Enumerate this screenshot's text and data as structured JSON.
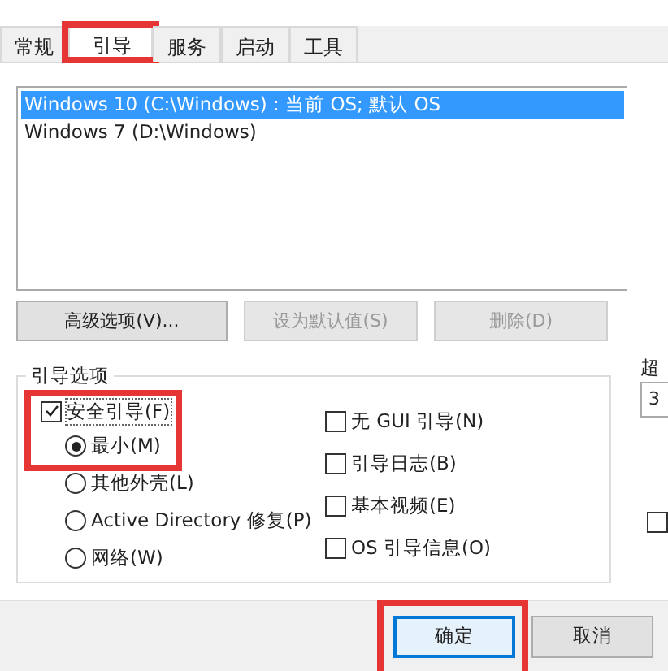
{
  "tabs": [
    {
      "label": "常规",
      "selected": false,
      "highlighted": false
    },
    {
      "label": "引导",
      "selected": true,
      "highlighted": true
    },
    {
      "label": "服务",
      "selected": false,
      "highlighted": false
    },
    {
      "label": "启动",
      "selected": false,
      "highlighted": false
    },
    {
      "label": "工具",
      "selected": false,
      "highlighted": false
    }
  ],
  "os_list": [
    {
      "label": "Windows 10 (C:\\Windows) : 当前 OS; 默认 OS",
      "selected": true
    },
    {
      "label": "Windows 7 (D:\\Windows)",
      "selected": false
    }
  ],
  "list_buttons": [
    {
      "label": "高级选项(V)...",
      "disabled": false
    },
    {
      "label": "设为默认值(S)",
      "disabled": true
    },
    {
      "label": "删除(D)",
      "disabled": true
    }
  ],
  "boot_options": {
    "title": "引导选项",
    "safe_boot": {
      "label": "安全引导(F)",
      "checked": true,
      "highlighted": true
    },
    "safe_boot_modes": [
      {
        "label": "最小(M)",
        "selected": true
      },
      {
        "label": "其他外壳(L)",
        "selected": false
      },
      {
        "label": "Active Directory 修复(P)",
        "selected": false
      },
      {
        "label": "网络(W)",
        "selected": false
      }
    ],
    "flags": [
      {
        "label": "无 GUI 引导(N)",
        "checked": false
      },
      {
        "label": "引导日志(B)",
        "checked": false
      },
      {
        "label": "基本视频(E)",
        "checked": false
      },
      {
        "label": "OS 引导信息(O)",
        "checked": false
      }
    ]
  },
  "timeout": {
    "label": "超",
    "value": "3"
  },
  "side_checkbox": {
    "checked": false
  },
  "footer_buttons": [
    {
      "label": "确定",
      "default": true,
      "highlighted": true
    },
    {
      "label": "取消",
      "default": false,
      "highlighted": false
    }
  ]
}
